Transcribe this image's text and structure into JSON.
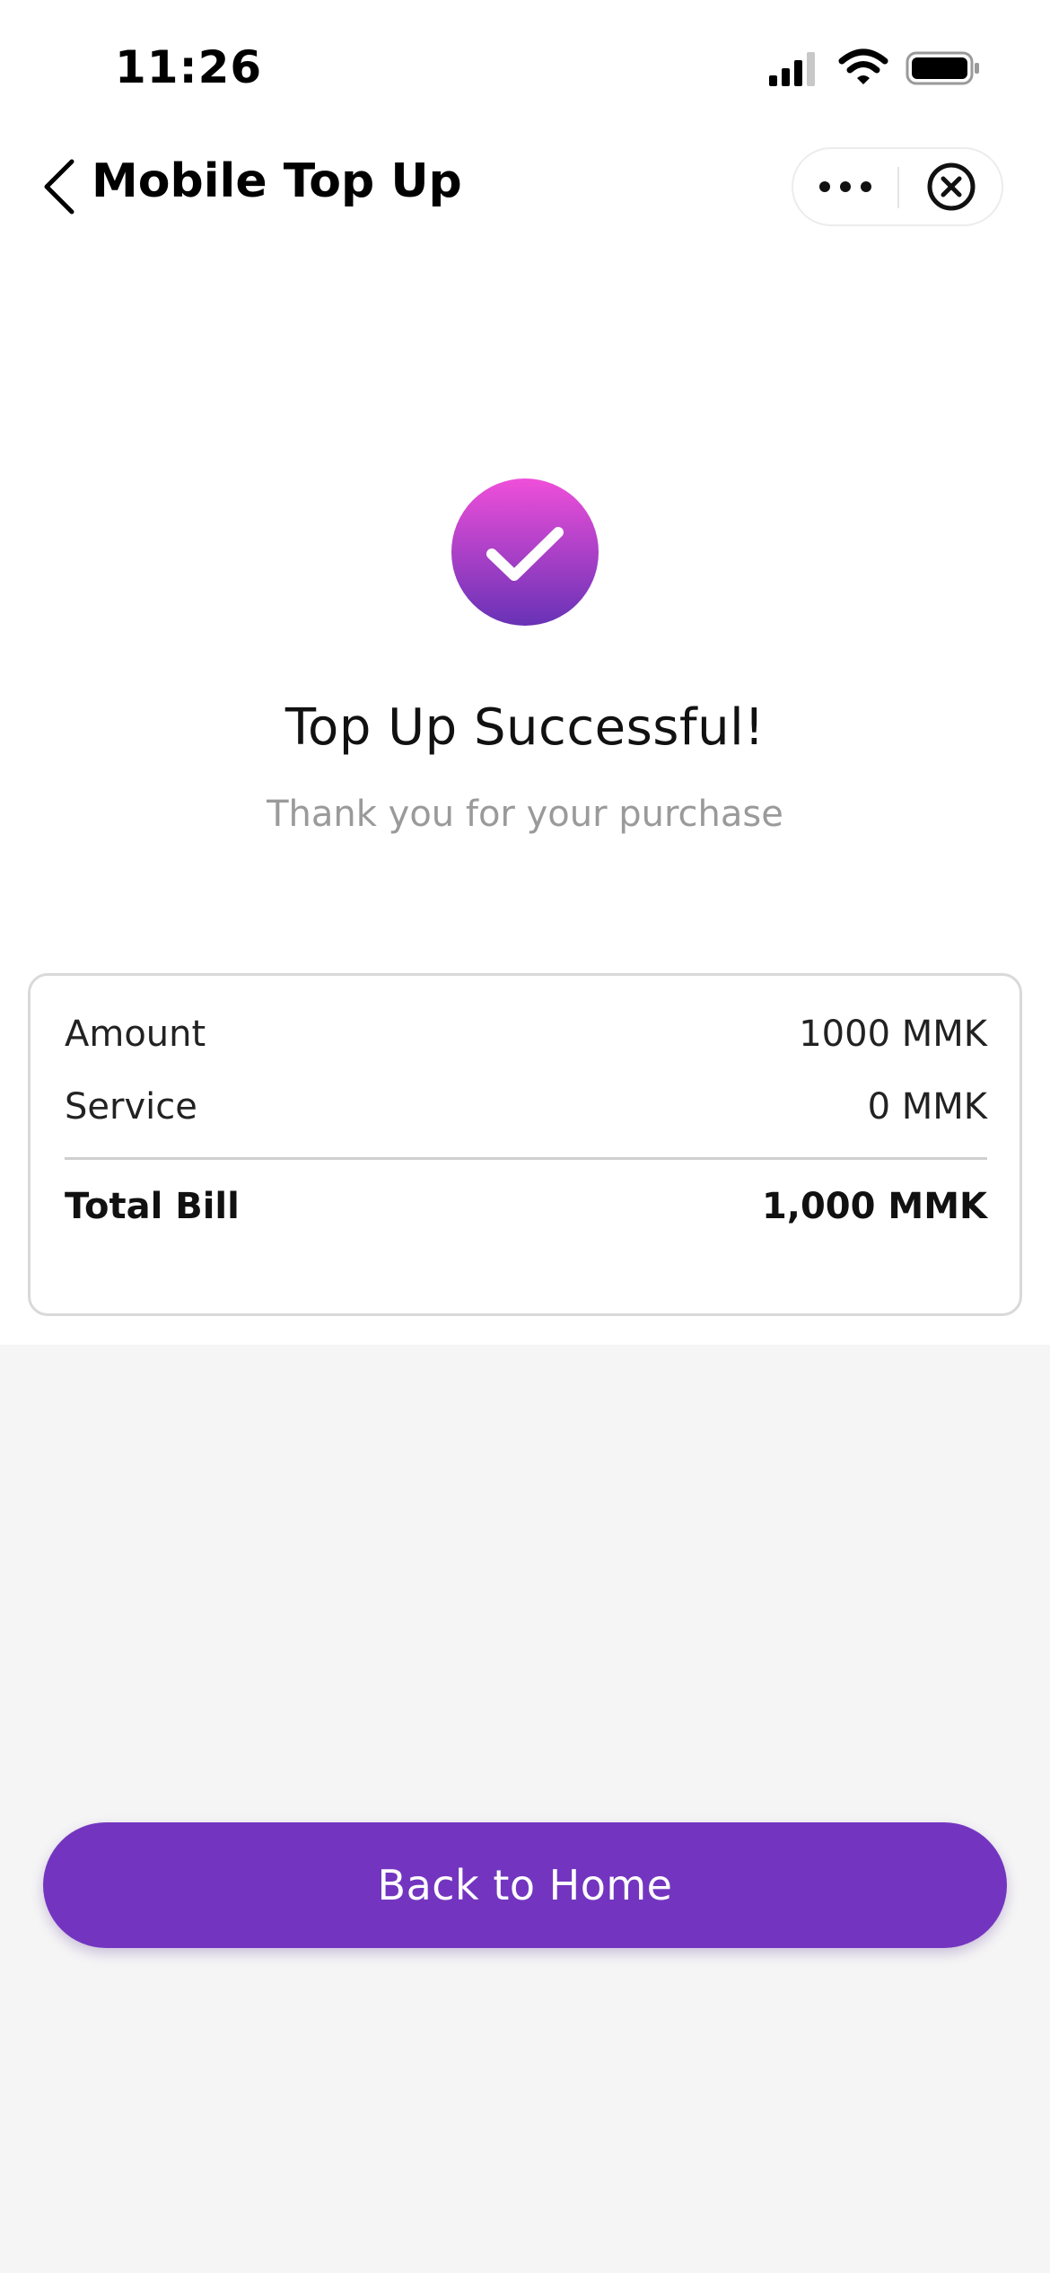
{
  "status_bar": {
    "time": "11:26",
    "icons": [
      "signal-icon",
      "wifi-icon",
      "battery-icon"
    ]
  },
  "nav": {
    "title": "Mobile Top Up",
    "icons": [
      "back-icon",
      "more-icon",
      "close-circle-icon"
    ]
  },
  "success": {
    "icon": "checkmark-icon",
    "title": "Top Up Successful!",
    "subtitle": "Thank you for your purchase"
  },
  "bill": {
    "rows": [
      {
        "label": "Amount",
        "value": "1000 MMK"
      },
      {
        "label": "Service",
        "value": "0 MMK"
      }
    ],
    "total": {
      "label": "Total Bill",
      "value": "1,000 MMK"
    }
  },
  "actions": {
    "back_home_label": "Back to Home"
  },
  "colors": {
    "brand_purple": "#7335c0",
    "gradient_top": "#e94fd6",
    "gradient_bottom": "#6a32b8",
    "page_background": "#f5f5f5",
    "card_border": "#d9d9d9",
    "subtitle_gray": "#9a9a9a"
  }
}
